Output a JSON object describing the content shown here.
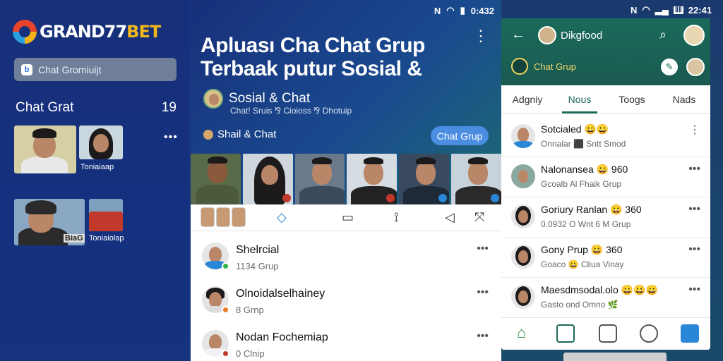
{
  "left": {
    "logo": {
      "main": "GRAND77",
      "accent": "BET"
    },
    "search_label": "Chat Gromiuijt",
    "heading": "Chat Grat",
    "heading_count": "19",
    "caption_1": "Toniaiaap",
    "caption_2": "Toniaiolap",
    "caption_tag": "BiaG",
    "more": "•••"
  },
  "middle": {
    "status_time": "0:432",
    "title_line1": "Apluası Cha Chat Grup",
    "title_line2": "Terbaak putur Sosial &",
    "more": "⋮",
    "sosial_title": "Sosial & Chat",
    "sosial_sub": "Chat! Sruis ⅋ Cioioss ⅋ Dhotuip",
    "shaill": "Shail & Chat",
    "chip_button": "Chat Grup",
    "chats": [
      {
        "name": "Shelrcial",
        "sub": "1134 Grup"
      },
      {
        "name": "Olnoidalselhainey",
        "sub": "8 Grnp"
      },
      {
        "name": "Nodan Fochemiap",
        "sub": "0 Clnip"
      }
    ],
    "row_more": "•••"
  },
  "right": {
    "status_time": "22:41",
    "status_batt": "ⅡⅡ",
    "header_title": "Dikgfood",
    "chat_group": "Chat Grup",
    "tabs": [
      "Adgniy",
      "Nous",
      "Toogs",
      "Nads"
    ],
    "rows": [
      {
        "name": "Sotcialed 😀😀",
        "sub": "Onnalar ⬛ Sntt Smod"
      },
      {
        "name": "Nalonansea 😀 960",
        "sub": "Gcoalb       Al Fhaik Grup"
      },
      {
        "name": "Goriury Ranlan 😀 360",
        "sub": "0.0932     O Wnt 6 M Grup"
      },
      {
        "name": "Gony Prup 😀 360",
        "sub": "Goaco  😀 Cliua Vinay"
      },
      {
        "name": "Maesdmsodal.olo 😀😀😀",
        "sub": "Gasto   ond Omno 🌿"
      }
    ],
    "more": "⋮",
    "row_more": "•••"
  },
  "colors": {
    "navy": "#17307a",
    "teal": "#1a6a5a",
    "chip": "#4b8de0",
    "accent_gold": "#f2b81c"
  }
}
